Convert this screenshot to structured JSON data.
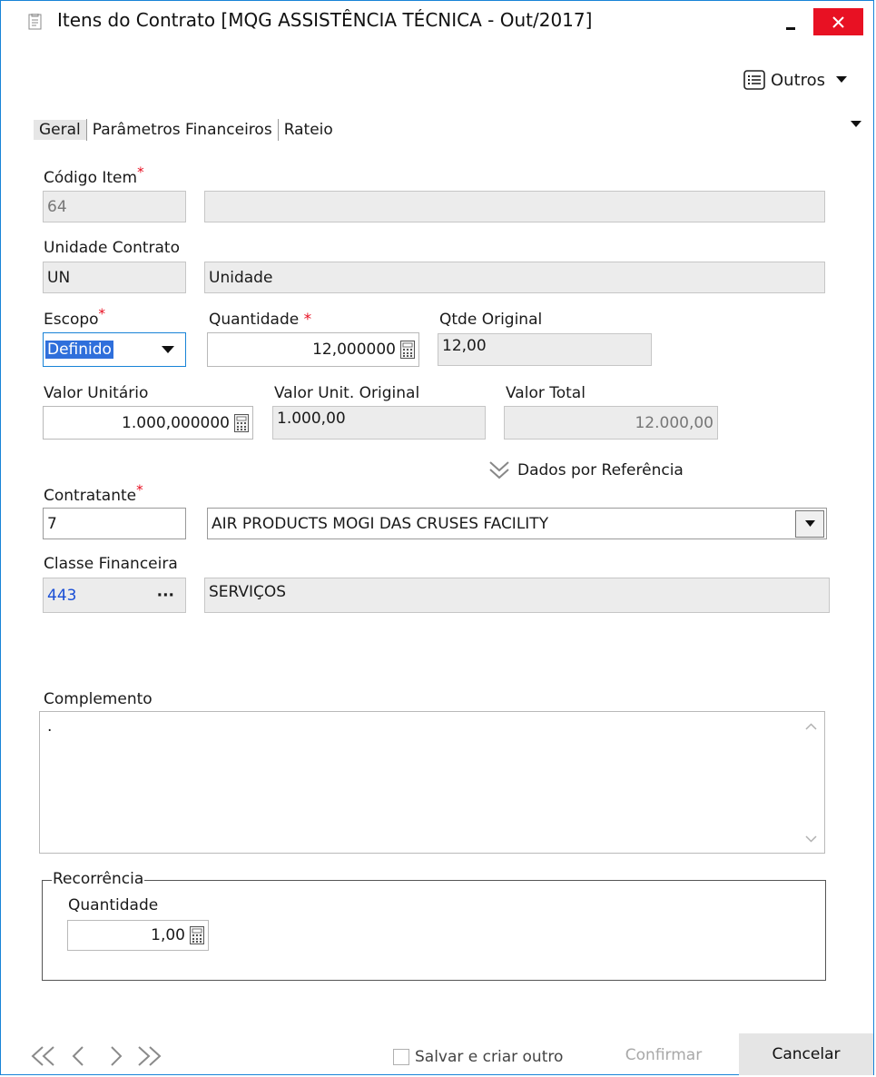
{
  "window": {
    "title": "Itens do Contrato [MQG ASSISTÊNCIA TÉCNICA - Out/2017]",
    "minimize_label": "–",
    "close_label": "✕"
  },
  "toolbar": {
    "outros_label": "Outros"
  },
  "tabs": [
    {
      "label": "Geral",
      "active": true
    },
    {
      "label": "Parâmetros Financeiros",
      "active": false
    },
    {
      "label": "Rateio",
      "active": false
    }
  ],
  "form": {
    "codigo_item": {
      "label": "Código Item",
      "required_mark": "*",
      "value": "64",
      "description": ""
    },
    "unidade_contrato": {
      "label": "Unidade Contrato",
      "code": "UN",
      "description": "Unidade"
    },
    "escopo": {
      "label": "Escopo",
      "required_mark": "*",
      "value": "Definido"
    },
    "quantidade": {
      "label": "Quantidade",
      "required_mark": "*",
      "value": "12,000000"
    },
    "qtde_original": {
      "label": "Qtde Original",
      "value": "12,00"
    },
    "valor_unitario": {
      "label": "Valor Unitário",
      "value": "1.000,000000"
    },
    "valor_unit_original": {
      "label": "Valor Unit. Original",
      "value": "1.000,00"
    },
    "valor_total": {
      "label": "Valor Total",
      "value": "12.000,00"
    },
    "dados_referencia_label": "Dados por Referência",
    "contratante": {
      "label": "Contratante",
      "required_mark": "*",
      "code": "7",
      "name": "AIR PRODUCTS MOGI DAS CRUSES FACILITY"
    },
    "classe_financeira": {
      "label": "Classe Financeira",
      "code": "443",
      "ellipsis": "···",
      "description": "SERVIÇOS"
    },
    "complemento": {
      "label": "Complemento",
      "value": "."
    },
    "recorrencia": {
      "legend": "Recorrência",
      "quantidade_label": "Quantidade",
      "quantidade_value": "1,00"
    }
  },
  "footer": {
    "nav": {
      "first": "«",
      "prev": "‹",
      "next": "›",
      "last": "»"
    },
    "salvar_criar_label": "Salvar e criar outro",
    "confirmar_label": "Confirmar",
    "cancelar_label": "Cancelar"
  },
  "colors": {
    "accent": "#1883d7",
    "close_button": "#e81123",
    "required": "#e81123",
    "link_blue": "#1a4fd6",
    "readonly_bg": "#ececec"
  }
}
